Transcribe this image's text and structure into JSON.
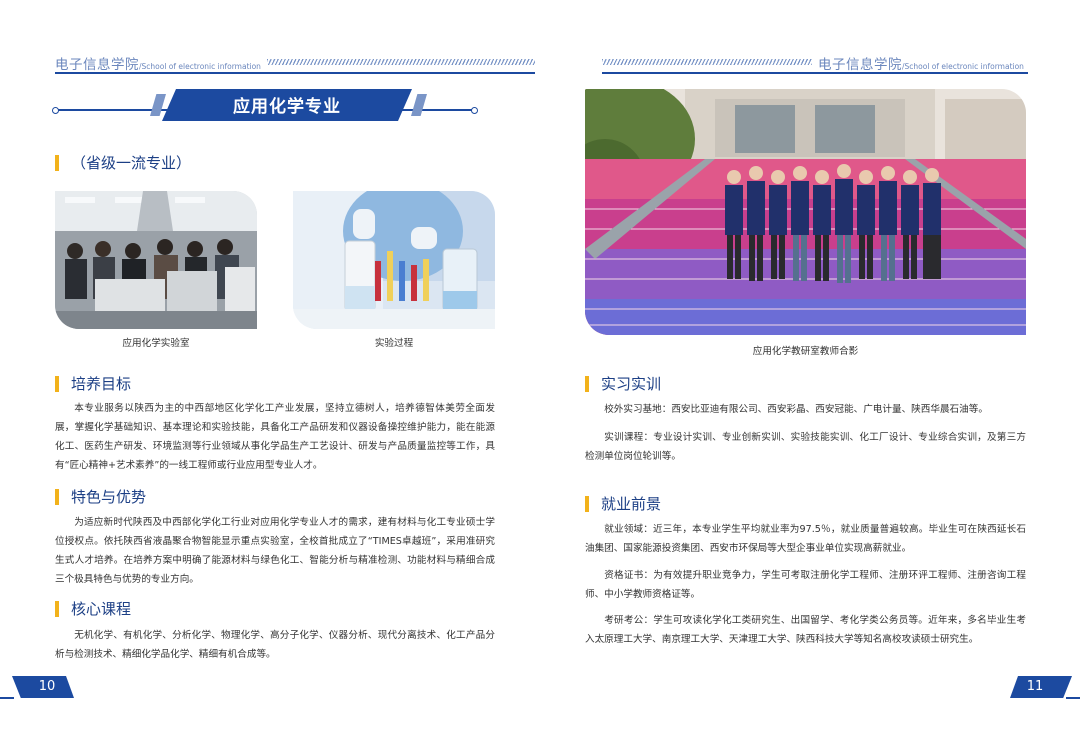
{
  "header": {
    "left_cn": "电子信息学院",
    "left_en": "/School of electronic information",
    "right_cn": "电子信息学院",
    "right_en": "/School of electronic information"
  },
  "banner_title": "应用化学专业",
  "subtitle": "（省级一流专业）",
  "photos": {
    "lab_caption": "应用化学实验室",
    "process_caption": "实验过程",
    "group_caption": "应用化学教研室教师合影"
  },
  "left": {
    "goal": {
      "title": "培养目标",
      "text": "本专业服务以陕西为主的中西部地区化学化工产业发展，坚持立德树人，培养德智体美劳全面发展，掌握化学基础知识、基本理论和实验技能，具备化工产品研发和仪器设备操控维护能力，能在能源化工、医药生产研发、环境监测等行业领域从事化学品生产工艺设计、研发与产品质量监控等工作，具有“匠心精神+艺术素养”的一线工程师或行业应用型专业人才。"
    },
    "features": {
      "title": "特色与优势",
      "text": "为适应新时代陕西及中西部化学化工行业对应用化学专业人才的需求，建有材料与化工专业硕士学位授权点。依托陕西省液晶聚合物智能显示重点实验室，全校首批成立了“TIMES卓越班”，采用准研究生式人才培养。在培养方案中明确了能源材料与绿色化工、智能分析与精准检测、功能材料与精细合成三个极具特色与优势的专业方向。"
    },
    "courses": {
      "title": "核心课程",
      "text": "无机化学、有机化学、分析化学、物理化学、高分子化学、仪器分析、现代分离技术、化工产品分析与检测技术、精细化学品化学、精细有机合成等。"
    }
  },
  "right": {
    "practice": {
      "title": "实习实训",
      "p1": "校外实习基地：西安比亚迪有限公司、西安彩晶、西安冠能、广电计量、陕西华晨石油等。",
      "p2": "实训课程：专业设计实训、专业创新实训、实验技能实训、化工厂设计、专业综合实训，及第三方检测单位岗位轮训等。"
    },
    "employment": {
      "title": "就业前景",
      "p1": "就业领域：近三年，本专业学生平均就业率为97.5％，就业质量普遍较高。毕业生可在陕西延长石油集团、国家能源投资集团、西安市环保局等大型企事业单位实现高薪就业。",
      "p2": "资格证书：为有效提升职业竞争力，学生可考取注册化学工程师、注册环评工程师、注册咨询工程师、中小学教师资格证等。",
      "p3": "考研考公：学生可攻读化学化工类研究生、出国留学、考化学类公务员等。近年来，多名毕业生考入太原理工大学、南京理工大学、天津理工大学、陕西科技大学等知名高校攻读硕士研究生。"
    }
  },
  "page_numbers": {
    "left": "10",
    "right": "11"
  },
  "colors": {
    "primary": "#1c4aa0",
    "accent": "#f2b21b",
    "header_text": "#6b87bd"
  }
}
